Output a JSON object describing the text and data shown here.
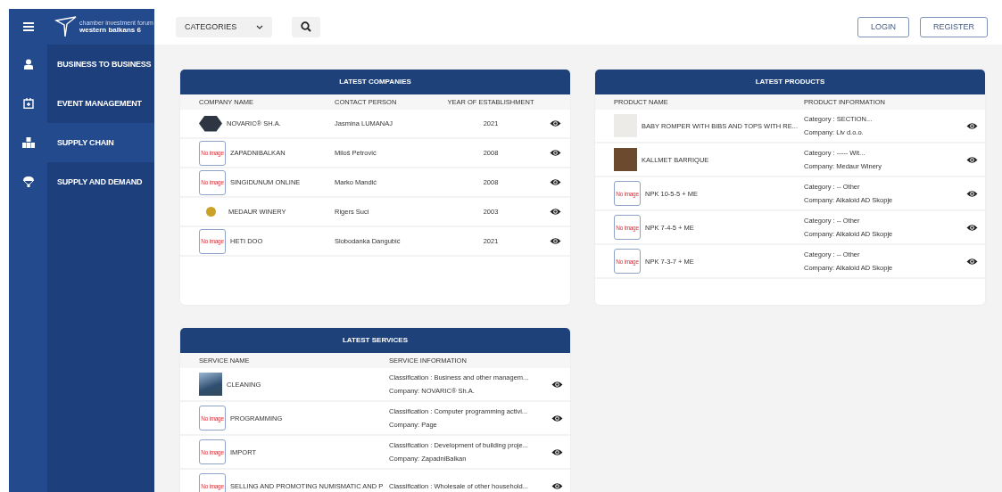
{
  "logo": {
    "tagline": "chamber investment forum",
    "name": "western balkans 6"
  },
  "sidebar": {
    "items": [
      {
        "label": "BUSINESS TO BUSINESS",
        "kind": "people",
        "selected": false
      },
      {
        "label": "EVENT MANAGEMENT",
        "kind": "calendar",
        "selected": false
      },
      {
        "label": "SUPPLY CHAIN",
        "kind": "boxes",
        "selected": true
      },
      {
        "label": "SUPPLY AND DEMAND",
        "kind": "balloon",
        "selected": false
      }
    ]
  },
  "topbar": {
    "categories": "CATEGORIES",
    "buttons": [
      "LOGIN",
      "REGISTER"
    ]
  },
  "companies": {
    "title": "LATEST COMPANIES",
    "columns": [
      "COMPANY NAME",
      "CONTACT PERSON",
      "YEAR OF ESTABLISHMENT"
    ],
    "rows": [
      {
        "thumb": {
          "kind": "hexlogo"
        },
        "name": "NOVARIC® SH.A.",
        "contact": "Jasmina LUMANAJ",
        "year": "2021"
      },
      {
        "thumb": {
          "kind": "none",
          "text": "No image"
        },
        "name": "ZAPADNIBALKAN",
        "contact": "Miloš Petrović",
        "year": "2008"
      },
      {
        "thumb": {
          "kind": "none",
          "text": "No image"
        },
        "name": "SINGIDUNUM ONLINE",
        "contact": "Marko Mandić",
        "year": "2008"
      },
      {
        "thumb": {
          "kind": "coinlogo"
        },
        "name": "MEDAUR WINERY",
        "contact": "Rigers Suci",
        "year": "2003"
      },
      {
        "thumb": {
          "kind": "none",
          "text": "No image"
        },
        "name": "HETI DOO",
        "contact": "Slobodanka Dangubić",
        "year": "2021"
      }
    ]
  },
  "products": {
    "title": "LATEST PRODUCTS",
    "columns": [
      "PRODUCT NAME",
      "PRODUCT INFORMATION"
    ],
    "rows": [
      {
        "thumb": {
          "kind": "photo"
        },
        "name": "BABY ROMPER WITH BIBS AND TOPS WITH RE...",
        "info": "Category : SECTION...",
        "company": "Company: Liv d.o.o."
      },
      {
        "thumb": {
          "kind": "photo"
        },
        "name": "KALLMET BARRIQUE",
        "info": "Category : ----- Wit...",
        "company": "Company: Medaur Winery"
      },
      {
        "thumb": {
          "kind": "none",
          "text": "No image"
        },
        "name": "NPK 10-5-5 + ME",
        "info": "Category : -- Other",
        "company": "Company: Alkaloid AD Skopje"
      },
      {
        "thumb": {
          "kind": "none",
          "text": "No image"
        },
        "name": "NPK 7-4-5 + ME",
        "info": "Category : -- Other",
        "company": "Company: Alkaloid AD Skopje"
      },
      {
        "thumb": {
          "kind": "none",
          "text": "No image"
        },
        "name": "NPK 7-3-7 + ME",
        "info": "Category : -- Other",
        "company": "Company: Alkaloid AD Skopje"
      }
    ]
  },
  "services": {
    "title": "LATEST SERVICES",
    "columns": [
      "SERVICE NAME",
      "SERVICE INFORMATION"
    ],
    "rows": [
      {
        "thumb": {
          "kind": "photo"
        },
        "name": "CLEANING",
        "info": "Classification : Business and other managem...",
        "company": "Company: NOVARIC® Sh.A."
      },
      {
        "thumb": {
          "kind": "none",
          "text": "No image"
        },
        "name": "PROGRAMMING",
        "info": "Classification : Computer programming activi...",
        "company": "Company: Page"
      },
      {
        "thumb": {
          "kind": "none",
          "text": "No image"
        },
        "name": "IMPORT",
        "info": "Classification : Development of building proje...",
        "company": "Company: ZapadniBalkan"
      },
      {
        "thumb": {
          "kind": "none",
          "text": "No image"
        },
        "name": "SELLING AND PROMOTING NUMISMATIC AND P",
        "info": "Classification : Wholesale of other household..."
      }
    ]
  }
}
